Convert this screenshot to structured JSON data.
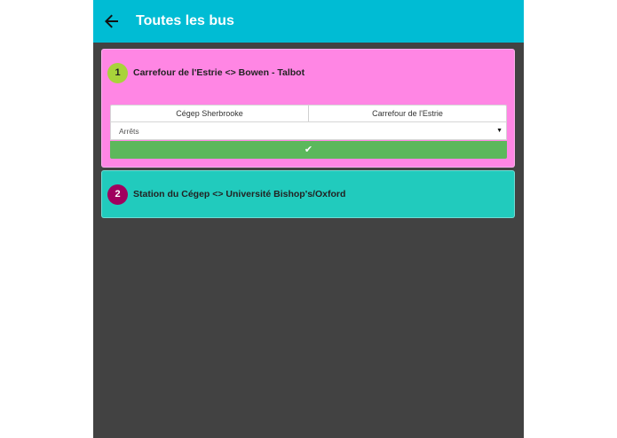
{
  "appbar": {
    "title": "Toutes les bus",
    "back_icon": "arrow-left-icon",
    "color": "#00bcd4"
  },
  "routes": [
    {
      "number": "1",
      "name": "Carrefour de l'Estrie <> Bowen - Talbot",
      "card_color": "#ff86e4",
      "badge_color": "#a8d33a",
      "expanded": true,
      "directions": [
        "Cégep Sherbrooke",
        "Carrefour de l'Estrie"
      ],
      "stops_select": {
        "value": "Arrêts"
      },
      "confirm_icon": "check-icon",
      "confirm_color": "#5cb85c"
    },
    {
      "number": "2",
      "name": "Station du Cégep <> Université Bishop's/Oxford",
      "card_color": "#21cbbd",
      "badge_color": "#a0005e",
      "expanded": false
    }
  ]
}
